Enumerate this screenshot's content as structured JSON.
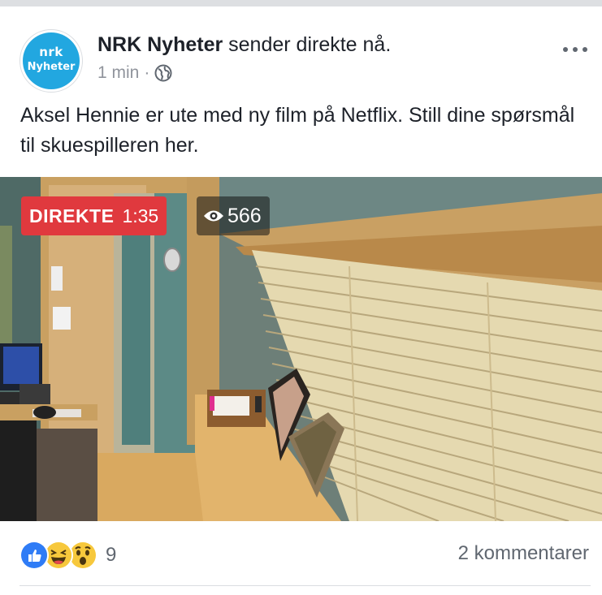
{
  "post": {
    "page_name": "NRK Nyheter",
    "action_text": " sender direkte nå.",
    "avatar_line1": "nrk",
    "avatar_line2": "Nyheter",
    "time": "1 min",
    "separator": "·",
    "privacy_icon": "globe-icon",
    "more_icon": "more-options-icon",
    "text": "Aksel Hennie er ute med ny film på Netflix. Still dine spørsmål til skuespilleren her."
  },
  "video": {
    "live_label": "DIREKTE",
    "live_time": "1:35",
    "viewer_icon": "eye-icon",
    "viewer_count": "566"
  },
  "footer": {
    "reaction_icons": [
      "like-icon",
      "haha-icon",
      "wow-icon"
    ],
    "reaction_count": "9",
    "comments": "2 kommentarer"
  },
  "colors": {
    "brand": "#22a7e0",
    "live": "#e0393e",
    "secondary_text": "#90949c"
  }
}
